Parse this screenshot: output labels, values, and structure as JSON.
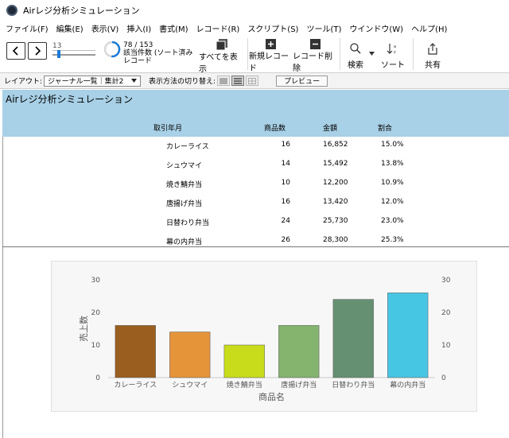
{
  "window": {
    "title": "Airレジ分析シミュレーション"
  },
  "menu": [
    "ファイル(F)",
    "編集(E)",
    "表示(V)",
    "挿入(I)",
    "書式(M)",
    "レコード(R)",
    "スクリプト(S)",
    "ツール(T)",
    "ウインドウ(W)",
    "ヘルプ(H)"
  ],
  "toolbar": {
    "record_value": "13",
    "record_progress": 0.51,
    "found_count": "78 / 153",
    "found_label": "該当件数 (ソート済み",
    "record_label": "レコード",
    "show_all": "すべてを表示",
    "new_record": "新規レコード",
    "delete_record": "レコード削除",
    "search": "検索",
    "sort": "ソート",
    "share": "共有"
  },
  "layoutbar": {
    "layout_label": "レイアウト:",
    "layout_value": "ジャーナル一覧｜集計2",
    "view_label": "表示方法の切り替え:",
    "preview": "プレビュー"
  },
  "report": {
    "title": "Airレジ分析シミュレーション",
    "columns": {
      "date": "取引年月",
      "qty": "商品数",
      "amount": "金額",
      "ratio": "割合"
    },
    "rows": [
      {
        "name": "カレーライス",
        "qty": "16",
        "amount": "16,852",
        "ratio": "15.0%"
      },
      {
        "name": "シュウマイ",
        "qty": "14",
        "amount": "15,492",
        "ratio": "13.8%"
      },
      {
        "name": "焼き鯖弁当",
        "qty": "10",
        "amount": "12,200",
        "ratio": "10.9%"
      },
      {
        "name": "唐揚げ弁当",
        "qty": "16",
        "amount": "13,420",
        "ratio": "12.0%"
      },
      {
        "name": "日替わり弁当",
        "qty": "24",
        "amount": "25,730",
        "ratio": "23.0%"
      },
      {
        "name": "幕の内弁当",
        "qty": "26",
        "amount": "28,300",
        "ratio": "25.3%"
      }
    ]
  },
  "chart_data": {
    "type": "bar",
    "categories": [
      "カレーライス",
      "シュウマイ",
      "焼き鯖弁当",
      "唐揚げ弁当",
      "日替わり弁当",
      "幕の内弁当"
    ],
    "values": [
      16,
      14,
      10,
      16,
      24,
      26
    ],
    "colors": [
      "#9a5f1e",
      "#e5943a",
      "#c9dc1c",
      "#84b46e",
      "#669072",
      "#47c6e4"
    ],
    "xlabel": "商品名",
    "ylabel": "売上数",
    "ylim": [
      0,
      30
    ],
    "yticks": [
      0,
      10,
      20,
      30
    ],
    "secondary_axis": true,
    "grid": false
  }
}
